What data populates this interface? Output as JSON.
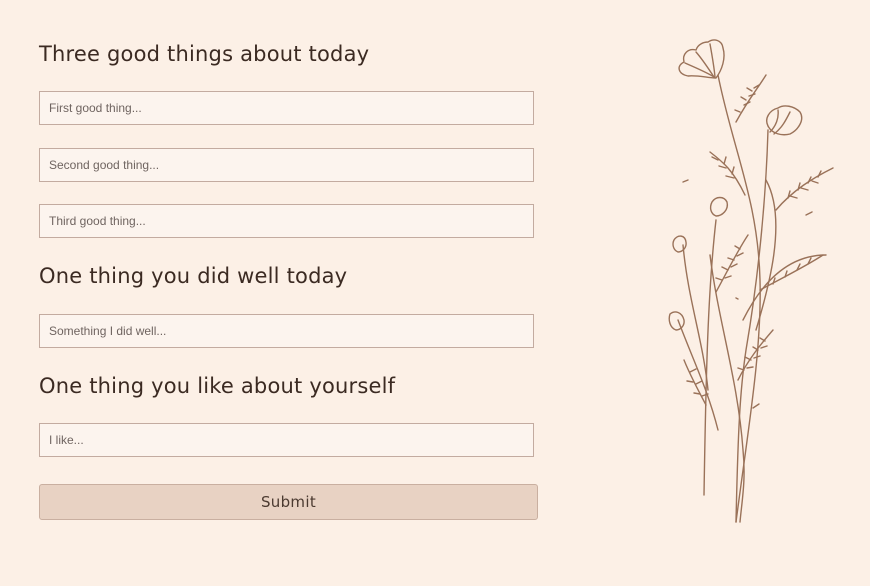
{
  "sections": {
    "good_things": {
      "heading": "Three good things about today",
      "fields": [
        {
          "placeholder": "First good thing...",
          "value": ""
        },
        {
          "placeholder": "Second good thing...",
          "value": ""
        },
        {
          "placeholder": "Third good thing...",
          "value": ""
        }
      ]
    },
    "did_well": {
      "heading": "One thing you did well today",
      "field": {
        "placeholder": "Something I did well...",
        "value": ""
      }
    },
    "like_yourself": {
      "heading": "One thing you like about yourself",
      "field": {
        "placeholder": "I like...",
        "value": ""
      }
    }
  },
  "submit_label": "Submit",
  "illustration": {
    "icon": "wildflower-bouquet-icon",
    "stroke_color": "#9a7259"
  },
  "colors": {
    "background": "#fcf0e6",
    "heading_text": "#3b2a22",
    "field_border": "#c3aba0",
    "field_background": "#fcf4ee",
    "button_background": "#e8d2c3"
  }
}
